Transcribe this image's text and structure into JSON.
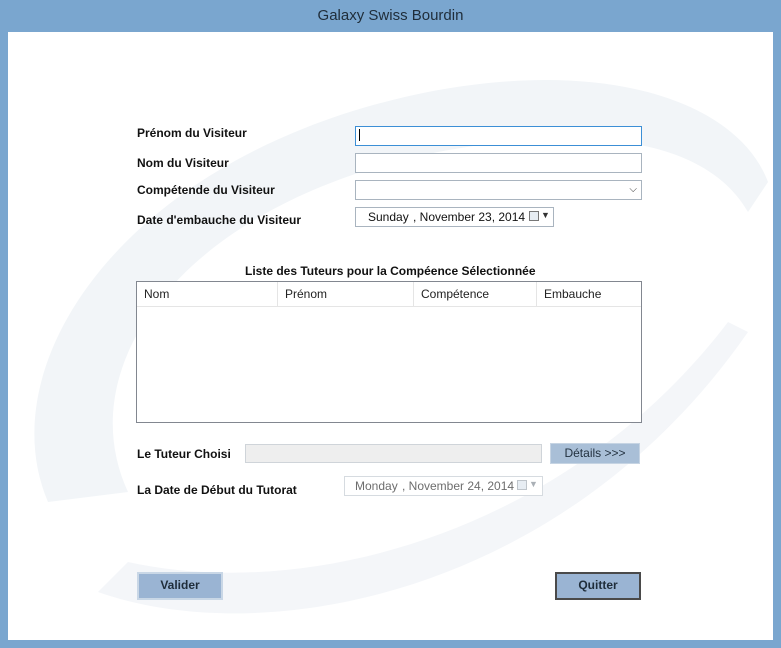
{
  "window": {
    "title": "Galaxy Swiss Bourdin"
  },
  "form": {
    "prenom_label": "Prénom du Visiteur",
    "prenom_value": "",
    "nom_label": "Nom du Visiteur",
    "nom_value": "",
    "competence_label": "Compétende du Visiteur",
    "competence_value": "",
    "embauche_label": "Date d'embauche du Visiteur",
    "embauche_day": "Sunday",
    "embauche_date": ", November 23, 2014"
  },
  "list": {
    "title": "Liste des Tuteurs pour la Compéence Sélectionnée",
    "columns": [
      "Nom",
      "Prénom",
      "Compétence",
      "Embauche"
    ],
    "rows": []
  },
  "tuteur": {
    "label": "Le Tuteur Choisi",
    "value": "",
    "details_label": "Détails >>>"
  },
  "tutorat": {
    "label": "La Date de Début du Tutorat",
    "day": "Monday",
    "date": ", November 24, 2014"
  },
  "buttons": {
    "valider": "Valider",
    "quitter": "Quitter"
  }
}
